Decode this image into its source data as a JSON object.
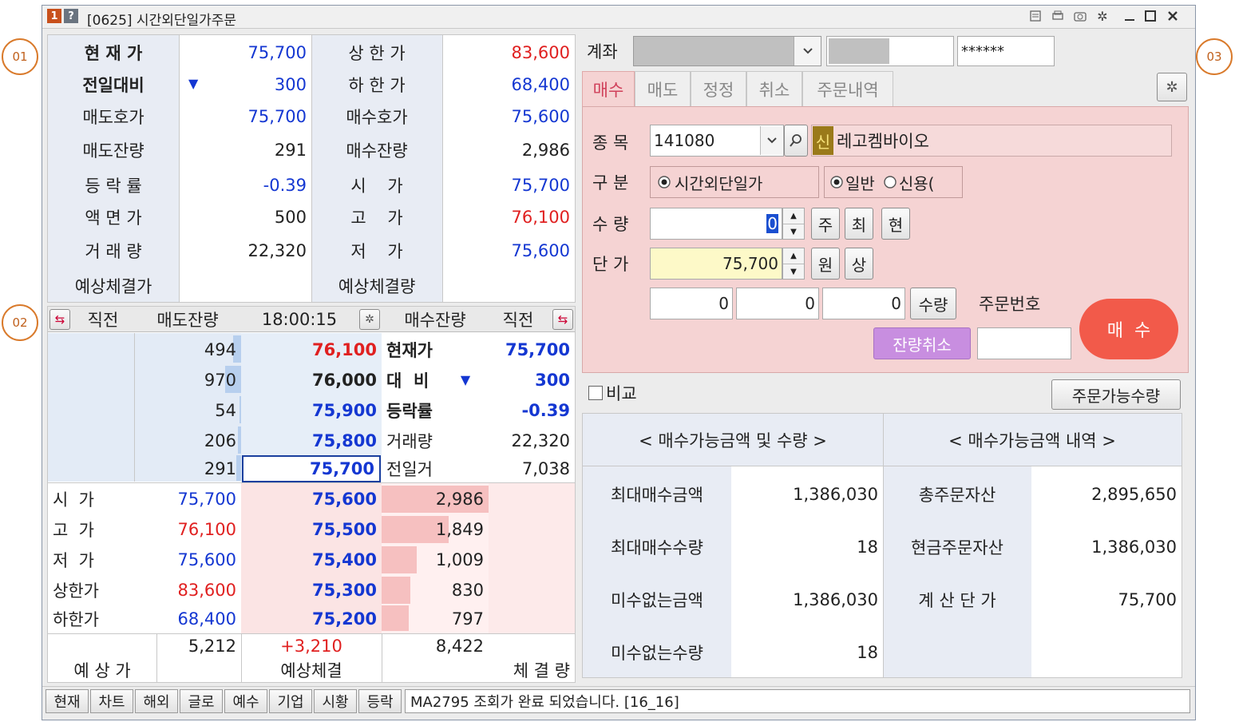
{
  "window": {
    "title": "[0625] 시간외단일가주문",
    "icon1": "1",
    "icon2": "?"
  },
  "callouts": [
    "01",
    "02",
    "03"
  ],
  "summary": {
    "left": [
      {
        "label": "현 재 가",
        "value": "75,700"
      },
      {
        "label": "전일대비",
        "value": "300",
        "arrow": "▼"
      },
      {
        "label": "매도호가",
        "value": "75,700"
      },
      {
        "label": "매도잔량",
        "value": "291"
      },
      {
        "label": "등 락 률",
        "value": "-0.39"
      },
      {
        "label": "액 면 가",
        "value": "500"
      },
      {
        "label": "거 래 량",
        "value": "22,320"
      },
      {
        "label": "예상체결가",
        "value": ""
      }
    ],
    "right": [
      {
        "label": "상 한 가",
        "value": "83,600"
      },
      {
        "label": "하 한 가",
        "value": "68,400"
      },
      {
        "label": "매수호가",
        "value": "75,600"
      },
      {
        "label": "매수잔량",
        "value": "2,986"
      },
      {
        "label": "시    가",
        "value": "75,700"
      },
      {
        "label": "고    가",
        "value": "76,100"
      },
      {
        "label": "저    가",
        "value": "75,600"
      },
      {
        "label": "예상체결량",
        "value": ""
      }
    ]
  },
  "orderbook": {
    "header": {
      "prev1": "직전",
      "sell": "매도잔량",
      "time": "18:00:15",
      "buy": "매수잔량",
      "prev2": "직전"
    },
    "asks": [
      {
        "qty": "494",
        "price": "76,100"
      },
      {
        "qty": "970",
        "price": "76,000"
      },
      {
        "qty": "54",
        "price": "75,900"
      },
      {
        "qty": "206",
        "price": "75,800"
      },
      {
        "qty": "291",
        "price": "75,700"
      }
    ],
    "info": [
      {
        "label": "현재가",
        "value": "75,700"
      },
      {
        "label": "대  비",
        "value": "300",
        "arrow": "▼"
      },
      {
        "label": "등락률",
        "value": "-0.39"
      },
      {
        "label": "거래량",
        "value": "22,320"
      },
      {
        "label": "전일거",
        "value": "7,038"
      }
    ],
    "bids": [
      {
        "price": "75,600",
        "qty": "2,986",
        "ratio": 1.0
      },
      {
        "price": "75,500",
        "qty": "1,849",
        "ratio": 0.62
      },
      {
        "price": "75,400",
        "qty": "1,009",
        "ratio": 0.34
      },
      {
        "price": "75,300",
        "qty": "830",
        "ratio": 0.28
      },
      {
        "price": "75,200",
        "qty": "797",
        "ratio": 0.27
      }
    ],
    "stats": [
      {
        "label": "시  가",
        "value": "75,700"
      },
      {
        "label": "고  가",
        "value": "76,100"
      },
      {
        "label": "저  가",
        "value": "75,600"
      },
      {
        "label": "상한가",
        "value": "83,600"
      },
      {
        "label": "하한가",
        "value": "68,400"
      }
    ],
    "footer": {
      "sell_total": "5,212",
      "diff": "+3,210",
      "buy_total": "8,422",
      "expected_price_label": "예 상 가",
      "expected_exec_label": "예상체결",
      "exec_qty_label": "체 결 량"
    }
  },
  "order": {
    "account_label": "계좌",
    "password": "******",
    "tabs": [
      "매수",
      "매도",
      "정정",
      "취소",
      "주문내역"
    ],
    "stock_label": "종 목",
    "stock_code": "141080",
    "stock_badge": "신",
    "stock_name": "레고켐바이오",
    "type_label": "구 분",
    "type_option": "시간외단일가",
    "mode_general": "일반",
    "mode_credit": "신용(",
    "qty_label": "수 량",
    "qty_value": "0",
    "qty_btns": [
      "주",
      "최",
      "현"
    ],
    "price_label": "단 가",
    "price_value": "75,700",
    "price_btns": [
      "원",
      "상"
    ],
    "extra_values": [
      "0",
      "0",
      "0"
    ],
    "extra_btn": "수량",
    "order_no_label": "주문번호",
    "cancel_remaining": "잔량취소",
    "buy_button": "매  수"
  },
  "compare": {
    "checkbox_label": "비교",
    "available_btn": "주문가능수량"
  },
  "avail": {
    "header_left": "< 매수가능금액 및 수량 >",
    "header_right": "< 매수가능금액 내역 >",
    "rows": [
      {
        "l1": "최대매수금액",
        "v1": "1,386,030",
        "l2": "총주문자산",
        "v2": "2,895,650"
      },
      {
        "l1": "최대매수수량",
        "v1": "18",
        "l2": "현금주문자산",
        "v2": "1,386,030"
      },
      {
        "l1": "미수없는금액",
        "v1": "1,386,030",
        "l2": "계 산 단 가",
        "v2": "75,700"
      },
      {
        "l1": "미수없는수량",
        "v1": "18",
        "l2": "",
        "v2": ""
      }
    ]
  },
  "statusbar": {
    "buttons": [
      "현재",
      "차트",
      "해외",
      "글로",
      "예수",
      "기업",
      "시황",
      "등락"
    ],
    "message": "MA2795 조회가 완료 되었습니다. [16_16]"
  },
  "colors": {
    "price_up": "#e02020",
    "price_down": "#1437d2",
    "order_panel_bg": "#f5d3d3",
    "buy_button": "#f25a4a",
    "cancel_button": "#c88ee0"
  }
}
